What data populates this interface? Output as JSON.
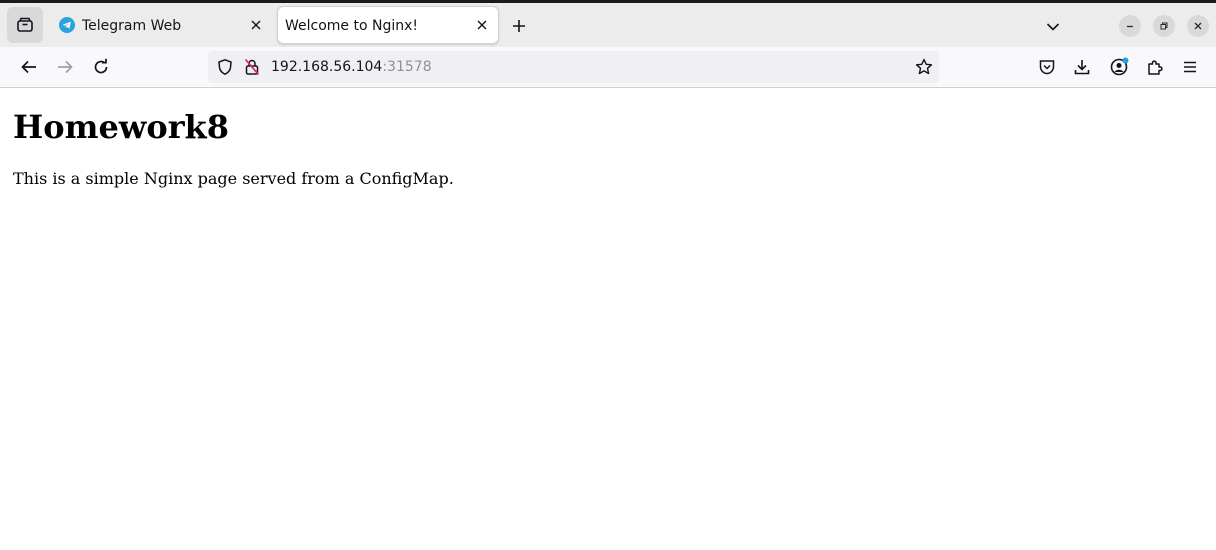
{
  "window": {
    "tabs": [
      {
        "title": "Telegram Web",
        "favicon": "telegram-icon",
        "active": false
      },
      {
        "title": "Welcome to Nginx!",
        "active": true
      }
    ],
    "controls": [
      "minimize-icon",
      "restore-icon",
      "close-icon"
    ]
  },
  "navigation": {
    "url_host": "192.168.56.104",
    "url_port": ":31578",
    "icons": [
      "back-arrow-icon",
      "forward-arrow-icon",
      "reload-icon",
      "shield-icon",
      "insecure-lock-icon",
      "bookmark-star-icon",
      "pocket-icon",
      "downloads-icon",
      "account-icon",
      "extensions-icon",
      "menu-icon"
    ]
  },
  "page": {
    "heading": "Homework8",
    "text": "This is a simple Nginx page served from a ConfigMap."
  },
  "colors": {
    "tab_bar": "#ececec",
    "toolbar": "#f9f9fb",
    "url_field": "#f0f0f4",
    "telegram_blue": "#2aa3df",
    "account_dot": "#1e9fe8",
    "insecure_red": "#e22850"
  }
}
